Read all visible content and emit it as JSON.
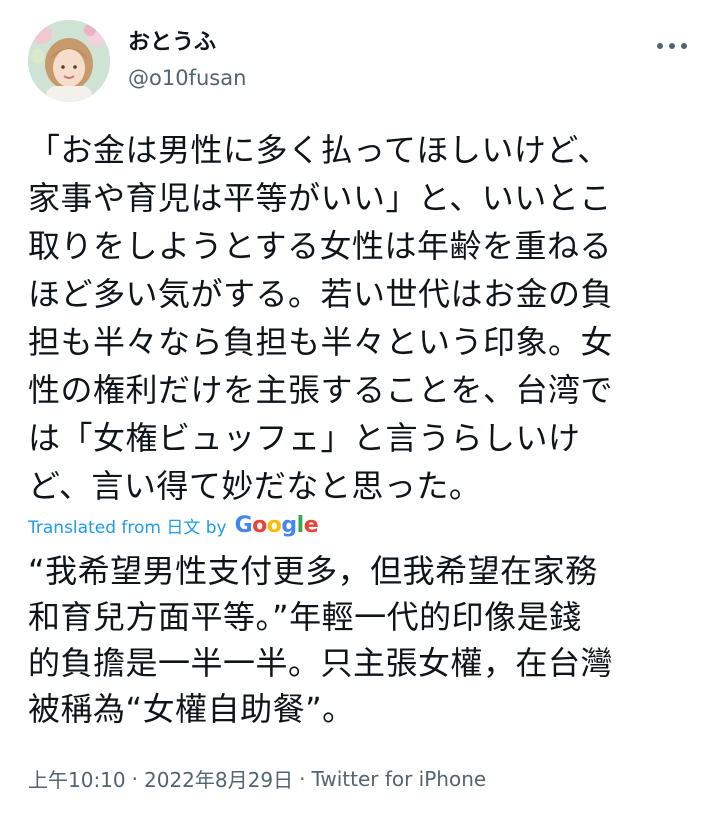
{
  "user": {
    "display_name": "おとうふ",
    "handle": "@o10fusan"
  },
  "menu": {
    "icon": "more-horizontal-icon"
  },
  "tweet": {
    "text": "「お金は男性に多く払ってほしいけど、\n家事や育児は平等がいい」と、いいとこ\n取りをしようとする女性は年齢を重ねる\nほど多い気がする。若い世代はお金の負\n担も半々なら負担も半々という印象。女\n性の権利だけを主張することを、台湾で\nは「女権ビュッフェ」と言うらしいけ\nど、言い得て妙だなと思った。",
    "translation_label": "Translated from 日文 by",
    "translation_brand": [
      "G",
      "o",
      "o",
      "g",
      "l",
      "e"
    ],
    "translation_text": "“我希望男性支付更多，但我希望在家務\n和育兒方面平等。”年輕一代的印像是錢\n的負擔是一半一半。只主張女權，在台灣\n被稱為“女權自助餐”。"
  },
  "meta": {
    "time": "上午10:10",
    "separator": "·",
    "date": "2022年8月29日",
    "source": "Twitter for iPhone"
  },
  "colors": {
    "link": "#1d9bf0",
    "secondary_text": "#536471",
    "primary_text": "#0f1419"
  }
}
